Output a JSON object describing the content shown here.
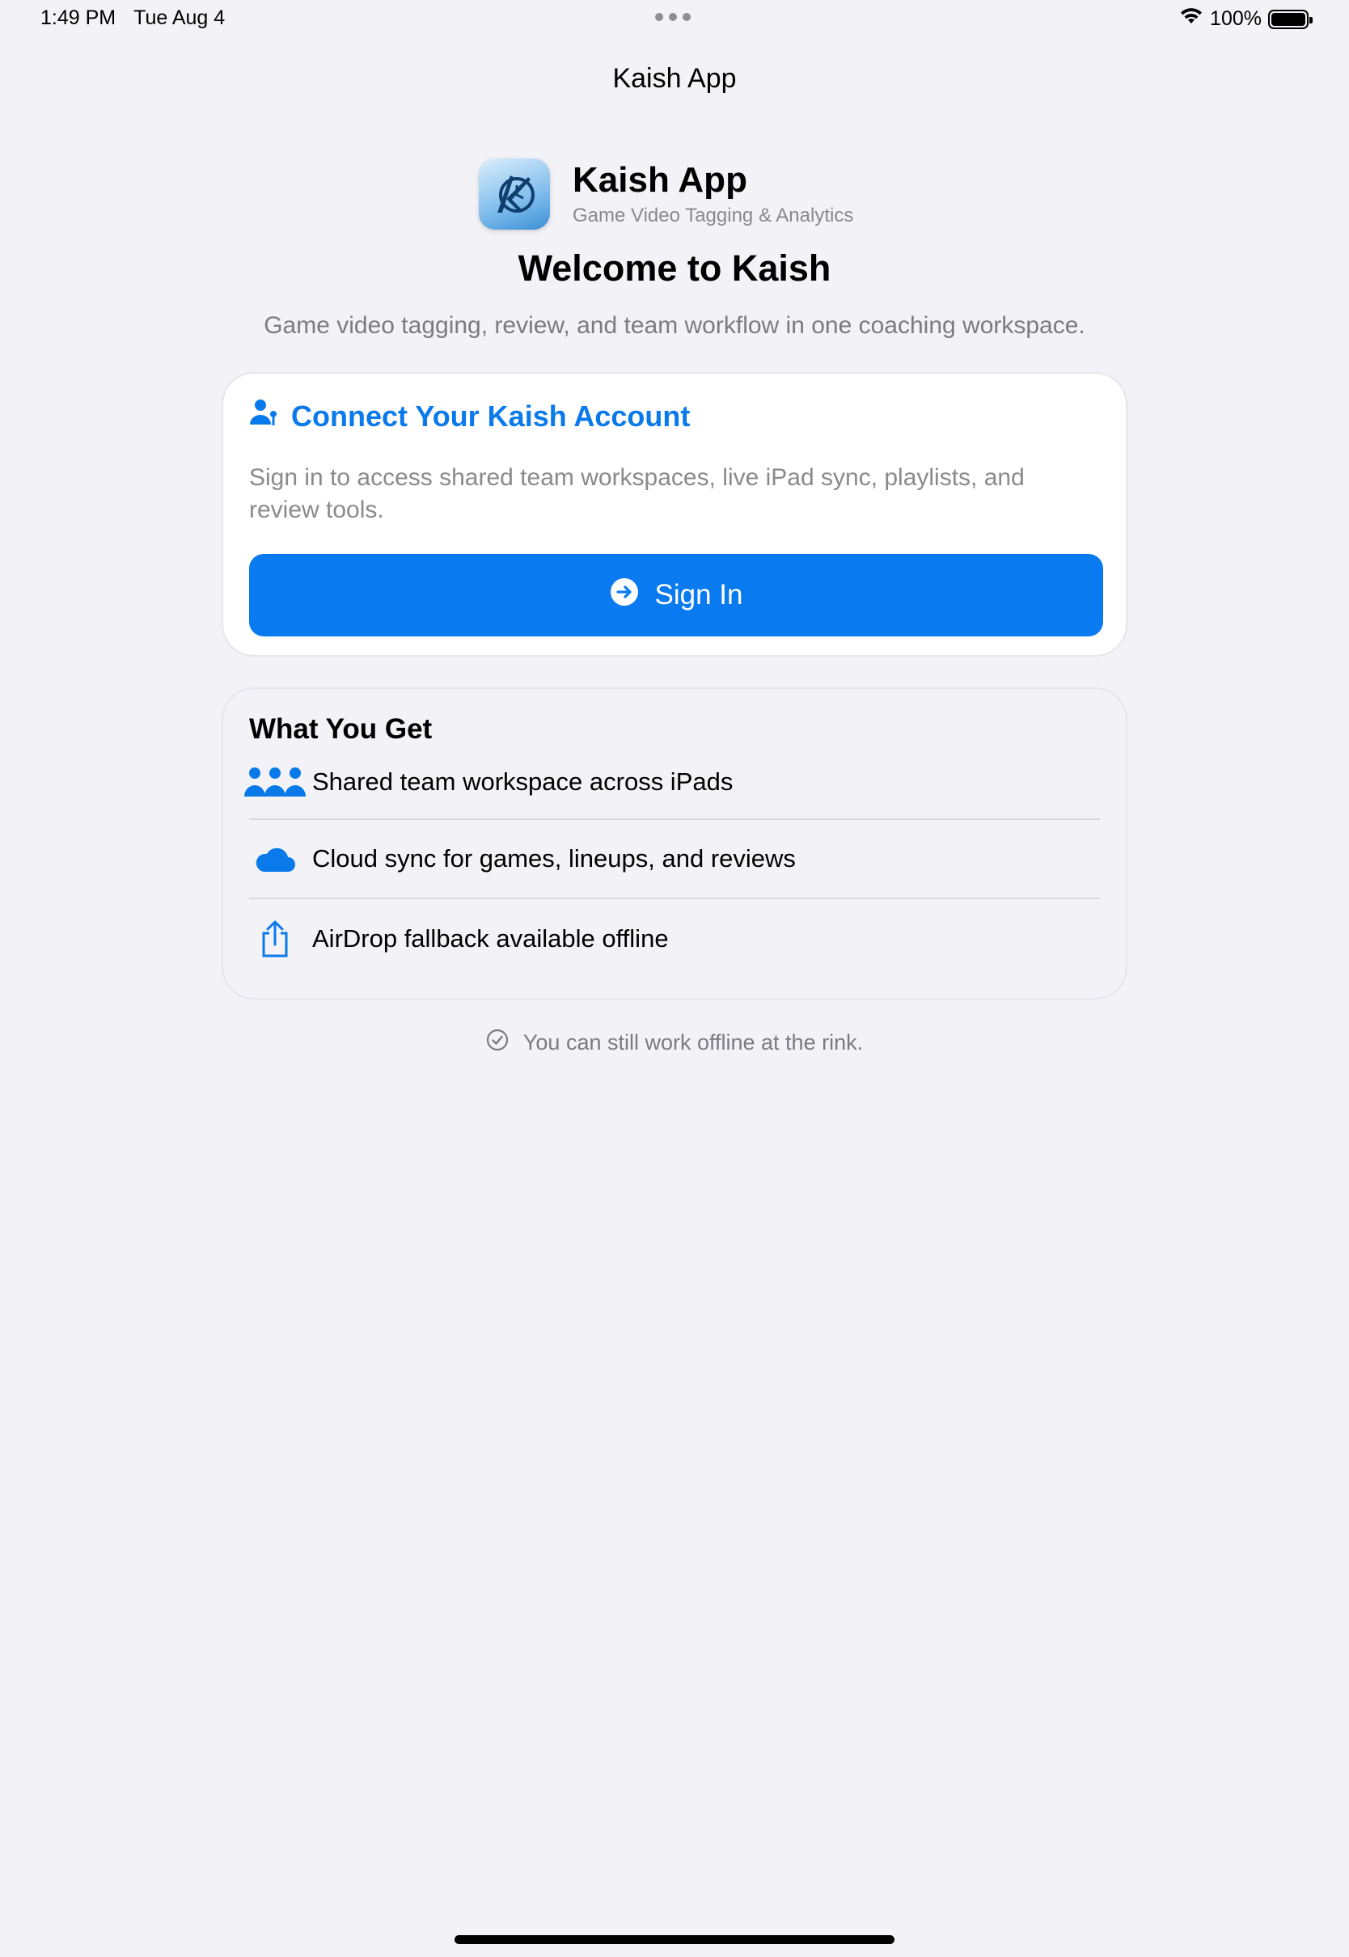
{
  "status_bar": {
    "time": "1:49 PM",
    "date": "Tue Aug 4",
    "battery": "100%"
  },
  "nav": {
    "title": "Kaish App"
  },
  "header": {
    "app_name": "Kaish App",
    "app_subtitle": "Game Video Tagging & Analytics",
    "welcome": "Welcome to Kaish",
    "tagline": "Game video tagging, review, and team workflow in one coaching workspace."
  },
  "connect": {
    "title": "Connect Your Kaish Account",
    "description": "Sign in to access shared team workspaces, live iPad sync, playlists, and review tools.",
    "sign_in_label": "Sign In"
  },
  "features": {
    "title": "What You Get",
    "items": [
      {
        "icon": "people-icon",
        "label": "Shared team workspace across iPads"
      },
      {
        "icon": "cloud-icon",
        "label": "Cloud sync for games, lineups, and reviews"
      },
      {
        "icon": "share-icon",
        "label": "AirDrop fallback available offline"
      }
    ]
  },
  "offline_note": "You can still work offline at the rink.",
  "colors": {
    "accent": "#0a7af0",
    "background": "#f2f2f7",
    "muted": "#8a8a8e"
  }
}
